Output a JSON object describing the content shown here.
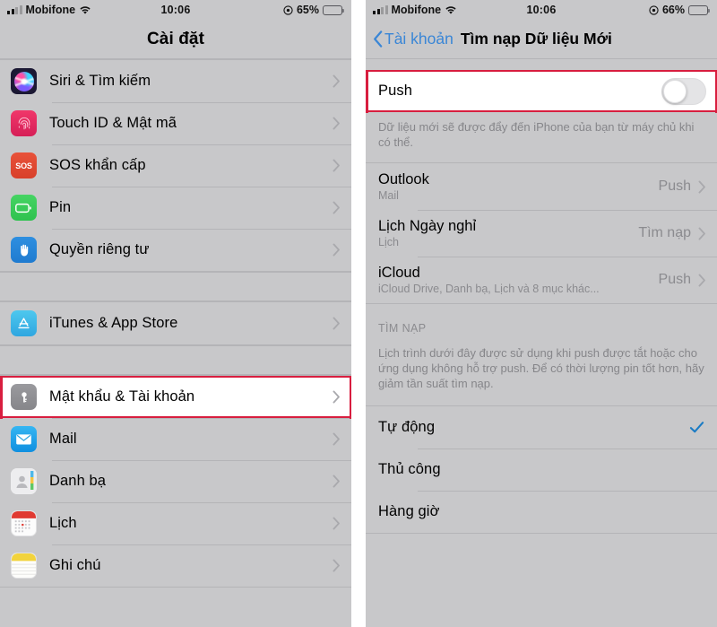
{
  "left": {
    "status": {
      "carrier": "Mobifone",
      "time": "10:06",
      "battery": "65%"
    },
    "title": "Cài đặt",
    "groups": [
      {
        "items": [
          {
            "label": "Siri & Tìm kiếm",
            "icon": "siri-icon"
          },
          {
            "label": "Touch ID & Mật mã",
            "icon": "touchid-icon"
          },
          {
            "label": "SOS khẩn cấp",
            "icon": "sos-icon",
            "icon_text": "SOS"
          },
          {
            "label": "Pin",
            "icon": "battery-icon"
          },
          {
            "label": "Quyền riêng tư",
            "icon": "privacy-hand-icon"
          }
        ]
      },
      {
        "items": [
          {
            "label": "iTunes & App Store",
            "icon": "app-store-icon"
          }
        ]
      },
      {
        "items": [
          {
            "label": "Mật khẩu & Tài khoản",
            "icon": "key-icon",
            "highlighted": true
          },
          {
            "label": "Mail",
            "icon": "mail-icon"
          },
          {
            "label": "Danh bạ",
            "icon": "contacts-icon"
          },
          {
            "label": "Lịch",
            "icon": "calendar-icon"
          },
          {
            "label": "Ghi chú",
            "icon": "notes-icon"
          }
        ]
      }
    ]
  },
  "right": {
    "status": {
      "carrier": "Mobifone",
      "time": "10:06",
      "battery": "66%"
    },
    "back_label": "Tài khoản",
    "title": "Tìm nạp Dữ liệu Mới",
    "push": {
      "label": "Push",
      "enabled": false,
      "footnote": "Dữ liệu mới sẽ được đẩy đến iPhone của bạn từ máy chủ khi có thể."
    },
    "accounts": [
      {
        "title": "Outlook",
        "subtitle": "Mail",
        "value": "Push"
      },
      {
        "title": "Lịch Ngày nghỉ",
        "subtitle": "Lịch",
        "value": "Tìm nạp"
      },
      {
        "title": "iCloud",
        "subtitle": "iCloud Drive, Danh bạ, Lịch và 8 mục khác...",
        "value": "Push"
      }
    ],
    "fetch_section": {
      "header": "TÌM NẠP",
      "footnote": "Lịch trình dưới đây được sử dụng khi push được tắt hoặc cho ứng dụng không hỗ trợ push. Để có thời lượng pin tốt hơn, hãy giảm tần suất tìm nạp.",
      "options": [
        {
          "label": "Tự động",
          "selected": true
        },
        {
          "label": "Thủ công",
          "selected": false
        },
        {
          "label": "Hàng giờ",
          "selected": false
        }
      ]
    }
  },
  "colors": {
    "accent_blue": "#3a86d6",
    "highlight_red": "#d81e3f",
    "background_grey": "#c8c8ca",
    "secondary_text": "#8b8b8f"
  }
}
